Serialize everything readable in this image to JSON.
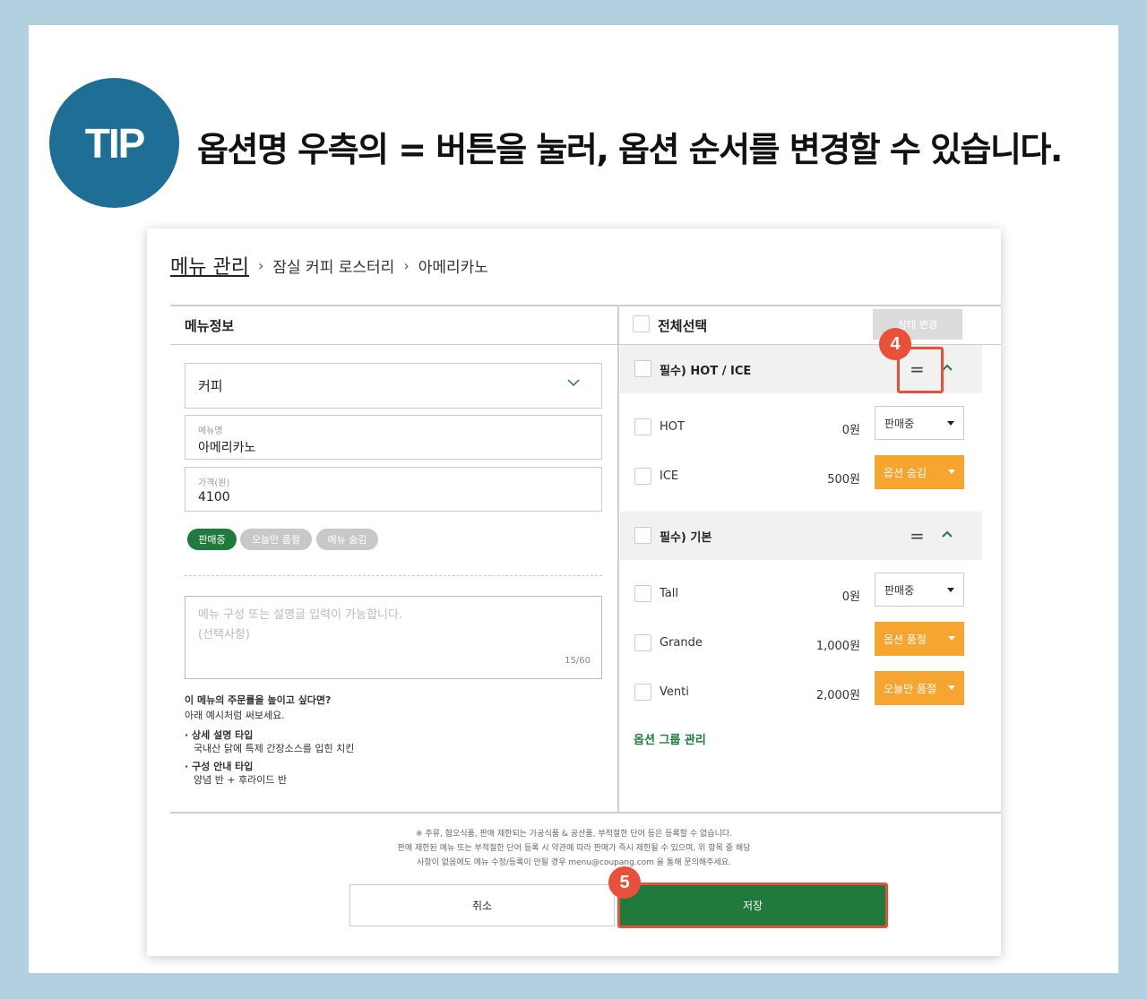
{
  "tip": {
    "badge": "TIP",
    "headline": "옵션명 우측의 = 버튼을 눌러, 옵션 순서를 변경할 수 있습니다."
  },
  "breadcrumb": {
    "root": "메뉴 관리",
    "store": "잠실 커피 로스터리",
    "item": "아메리카노",
    "separator": "›"
  },
  "left": {
    "header": "메뉴정보",
    "category": "커피",
    "name_label": "메뉴명",
    "name_value": "아메리카노",
    "price_label": "가격(원)",
    "price_value": "4100",
    "status_pills": [
      "판매중",
      "오늘만 품절",
      "메뉴 숨김"
    ],
    "description_placeholder_1": "메뉴 구성 또는 설명글 입력이 가능합니다.",
    "description_placeholder_2": "(선택사항)",
    "description_count": "15/60",
    "tips": {
      "title": "이 메뉴의 주문률을 높이고 싶다면?",
      "subtitle": "아래 예시처럼 써보세요.",
      "type1_title": "· 상세 설명 타입",
      "type1_example": "국내산 닭에 특제 간장소스를 입힌 치킨",
      "type2_title": "· 구성 안내 타입",
      "type2_example": "양념 반 + 후라이드 반"
    }
  },
  "right": {
    "select_all": "전체선택",
    "bulk_status_button": "상태 변경",
    "drag_symbol": "=",
    "groups": [
      {
        "label": "필수) HOT / ICE",
        "options": [
          {
            "label": "HOT",
            "price": "0원",
            "status": "판매중"
          },
          {
            "label": "ICE",
            "price": "500원",
            "status": "옵션 숨김"
          }
        ]
      },
      {
        "label": "필수) 기본",
        "options": [
          {
            "label": "Tall",
            "price": "0원",
            "status": "판매중"
          },
          {
            "label": "Grande",
            "price": "1,000원",
            "status": "옵션 품절"
          },
          {
            "label": "Venti",
            "price": "2,000원",
            "status": "오늘만 품절"
          }
        ]
      }
    ],
    "group_management": "옵션 그룹 관리"
  },
  "notice": {
    "line1": "※ 주류, 혐오식품, 판매 제한되는 가공식품 & 공산품, 부적절한 단어 등은 등록할 수 없습니다.",
    "line2": "판매 제한된 메뉴 또는 부적절한 단어 등록 시 약관에 따라 판매가 즉시 제한될 수 있으며, 위 항목 중 해당",
    "line3": "사항이 없음에도 메뉴 수정/등록이 안될 경우 menu@coupang.com 을 통해 문의해주세요."
  },
  "buttons": {
    "cancel": "취소",
    "save": "저장"
  },
  "steps": {
    "four": "4",
    "five": "5"
  },
  "colors": {
    "accent_green": "#1f7a3c",
    "highlight_red": "#e8503a",
    "status_orange": "#f6a530",
    "tip_blue": "#1e6e96",
    "background": "#b3d0e0"
  }
}
